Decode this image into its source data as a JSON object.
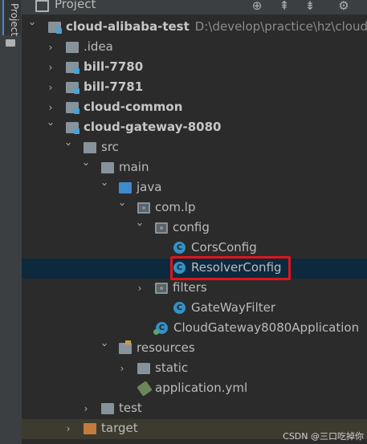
{
  "side_tab": {
    "label": "Project"
  },
  "toolbar": {
    "title": "Project",
    "caret": "▼",
    "icons": [
      "locate-icon",
      "collapse-all-icon",
      "expand-all-icon",
      "settings-icon"
    ],
    "locate": "⊕",
    "collapse": "⇞",
    "expand": "⇟",
    "settings": "⚙"
  },
  "tree": {
    "root": {
      "label": "cloud-alibaba-test",
      "path": "D:\\develop\\practice\\hz\\cloud-a"
    },
    "idea": ".idea",
    "bill1": "bill-7780",
    "bill2": "bill-7781",
    "common": "cloud-common",
    "gateway": "cloud-gateway-8080",
    "src": "src",
    "main": "main",
    "java": "java",
    "pkg": "com.lp",
    "config": "config",
    "cors": "CorsConfig",
    "resolver": "ResolverConfig",
    "filters": "filters",
    "gwfilter": "GateWayFilter",
    "app": "CloudGateway8080Application",
    "resources": "resources",
    "static": "static",
    "yml": "application.yml",
    "test": "test",
    "target": "target",
    "class_letter": "C"
  },
  "watermark": "CSDN @三口吃掉你",
  "colors": {
    "selected_row": "#0d293e",
    "highlight_box": "#e0151a",
    "target_row": "#3d3a2f"
  }
}
